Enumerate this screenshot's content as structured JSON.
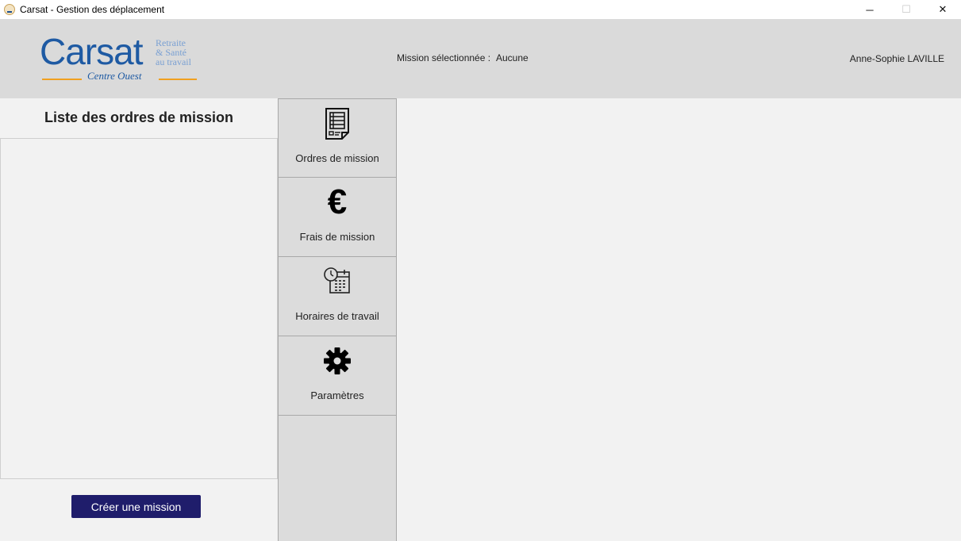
{
  "window": {
    "title": "Carsat - Gestion des déplacement",
    "controls": {
      "minimize": "─",
      "maximize": "☐",
      "close": "✕"
    }
  },
  "header": {
    "logo": {
      "main": "Carsat",
      "side_line1": "Retraite",
      "side_line2": "& Santé",
      "side_line3": "au travail",
      "sub": "Centre Ouest"
    },
    "mission_label": "Mission sélectionnée :",
    "mission_value": "Aucune",
    "user_name": "Anne-Sophie LAVILLE"
  },
  "left_panel": {
    "title": "Liste des ordres de mission",
    "items": [],
    "create_button": "Créer une mission"
  },
  "nav": {
    "items": [
      {
        "label": "Ordres de mission",
        "icon": "document-list-icon"
      },
      {
        "label": "Frais de mission",
        "icon": "euro-icon"
      },
      {
        "label": "Horaires de travail",
        "icon": "clock-calendar-icon"
      },
      {
        "label": "Paramètres",
        "icon": "gear-icon"
      }
    ]
  },
  "colors": {
    "header_bg": "#dadada",
    "panel_bg": "#f2f2f2",
    "nav_bg": "#dcdcdc",
    "button_bg": "#1f1d6b",
    "logo_blue": "#1e5aa3",
    "logo_orange": "#f0a020"
  }
}
